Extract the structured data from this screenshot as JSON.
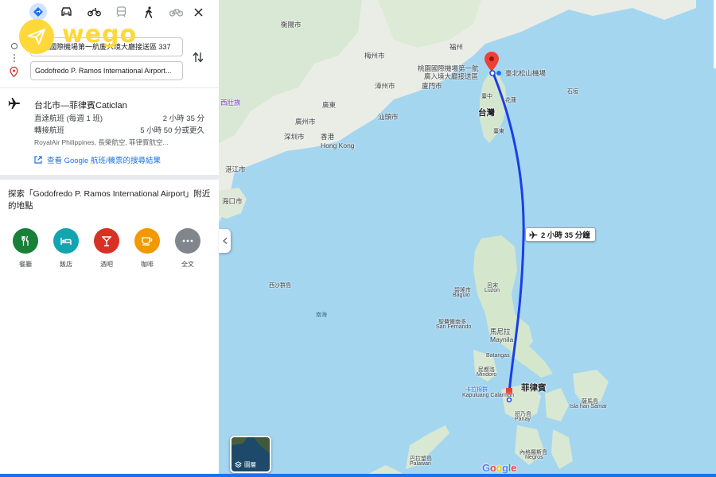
{
  "logo": {
    "text": "wego"
  },
  "travel_modes": [
    {
      "name": "best-route",
      "active": true
    },
    {
      "name": "car"
    },
    {
      "name": "motorcycle"
    },
    {
      "name": "transit"
    },
    {
      "name": "walk"
    },
    {
      "name": "bicycle"
    }
  ],
  "route": {
    "origin_value": "桃園國際機場第一航廈入境大廳接送區 337",
    "destination_value": "Godofredo P. Ramos International Airport..."
  },
  "flight": {
    "title": "台北市—菲律賓Caticlan",
    "rows": [
      {
        "label": "直達航班 (每週 1 班)",
        "value": "2 小時 35 分"
      },
      {
        "label": "轉接航班",
        "value": "5 小時 50 分或更久"
      }
    ],
    "airlines": "RoyalAir Philippines, 長榮航空, 菲律賓航空...",
    "link_label": "查看 Google 航班/機票的搜尋結果"
  },
  "explore": {
    "title": "探索「Godofredo P. Ramos International Airport」附近的地點",
    "categories": [
      {
        "label": "餐廳",
        "icon": "restaurant-icon",
        "color": "#188038"
      },
      {
        "label": "飯店",
        "icon": "hotel-icon",
        "color": "#12a4af"
      },
      {
        "label": "酒吧",
        "icon": "bar-icon",
        "color": "#d93025"
      },
      {
        "label": "咖啡",
        "icon": "cafe-icon",
        "color": "#f29900"
      },
      {
        "label": "全文",
        "icon": "more-icon",
        "color": "#80868b"
      }
    ]
  },
  "map": {
    "flight_duration": "2 小時 35 分鐘",
    "layers_label": "圖層",
    "attribution": "Google",
    "route_color": "#1a3ee8",
    "labels": {
      "xiamen_1": "衡陽市",
      "fuzhou": "福州",
      "taoyuan_airport_1": "桃園國際機場第一航",
      "taoyuan_airport_2": "廣入境大廳接送區",
      "songshan": "臺北松山機場",
      "zhangzhou": "漳州市",
      "xiamen": "廈門市",
      "taiwan": "台灣",
      "hualien": "花蓮",
      "taichung": "臺中",
      "taitung": "臺東",
      "guangdong": "廣東",
      "guangzhou": "廣州市",
      "shenzhen": "深圳市",
      "hongkong_zh": "香港",
      "hongkong_en": "Hong Kong",
      "zhanjiang": "湛江市",
      "haikou": "海口市",
      "guangxi": "西壯族",
      "shantou": "汕頭市",
      "meizhou": "梅州市",
      "xisha": "西沙群島",
      "nanhai": "南海",
      "baguio_zh": "碧瑤市",
      "baguio_en": "Baguio",
      "luzon_zh": "呂宋",
      "luzon_en": "Luzon",
      "sanfernando_zh": "聖費爾南多",
      "sanfernando_en": "San Fernando",
      "manila_zh": "馬尼拉",
      "manila_en": "Maynila",
      "batangas": "Batangas",
      "mindoro_zh": "民都洛",
      "mindoro_en": "Mindoro",
      "kalibo_zh": "卡拉棉群",
      "kalibo_en": "Kapuluang Calamian",
      "philippines": "菲律賓",
      "panay_zh": "班乃島",
      "panay_en": "Panay",
      "samar_zh": "薩馬島",
      "samar_en": "Isla han Samar",
      "negros_zh": "內格羅斯島",
      "negros_en": "Negros",
      "palawan_zh": "巴拉望島",
      "palawan_en": "Palawan",
      "ishigaki": "石垣"
    }
  }
}
